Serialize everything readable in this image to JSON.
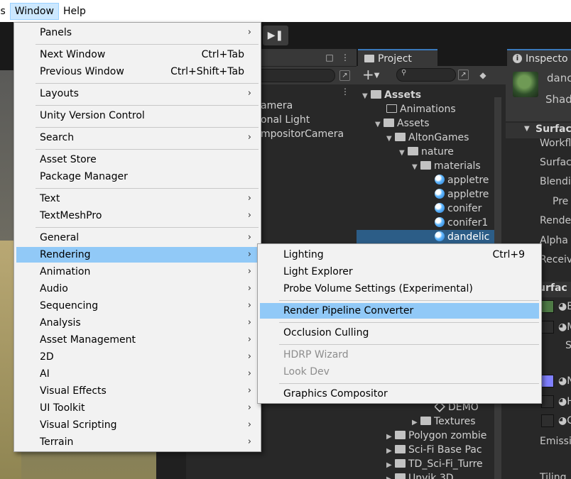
{
  "menubar": {
    "items": [
      "ols",
      "Window",
      "Help"
    ]
  },
  "toolbar": {
    "step_icon": "step-forward-icon"
  },
  "hierarchy": {
    "rows": [
      "amera",
      "onal Light",
      "mpositorCamera"
    ]
  },
  "project": {
    "tab_label": "Project",
    "add_label": "+",
    "tree": [
      {
        "label": "Assets",
        "bold": true
      },
      {
        "label": "Animations"
      },
      {
        "label": "Assets"
      },
      {
        "label": "AltonGames"
      },
      {
        "label": "nature"
      },
      {
        "label": "materials"
      },
      {
        "label": "appletre"
      },
      {
        "label": "appletre"
      },
      {
        "label": "conifer"
      },
      {
        "label": "conifer1"
      },
      {
        "label": "dandelic"
      },
      {
        "label": "DEMO"
      },
      {
        "label": "Textures"
      },
      {
        "label": "Polygon zombie"
      },
      {
        "label": "Sci-Fi Base Pac"
      },
      {
        "label": "TD_Sci-Fi_Turre"
      },
      {
        "label": "Unyik 3D"
      }
    ]
  },
  "inspector": {
    "tab_label": "Inspecto",
    "name": "danc",
    "shader": "Shad",
    "section1": "Surfac",
    "fields": [
      "Workfl",
      "Surfac",
      "Blendi",
      "Pre",
      "Rende",
      "Alpha",
      "Receiv"
    ],
    "section2": "urfac",
    "map_letters": [
      "B",
      "M",
      "S",
      "N",
      "H",
      "C"
    ],
    "emission": "Emissi",
    "tiling": "Tiling",
    "colors": {
      "base_map": "#4e7a45",
      "normal_map": "#8080ff"
    }
  },
  "window_menu": {
    "items": [
      {
        "label": "Panels",
        "submenu": true
      },
      {
        "sep": true
      },
      {
        "label": "Next Window",
        "shortcut": "Ctrl+Tab"
      },
      {
        "label": "Previous Window",
        "shortcut": "Ctrl+Shift+Tab"
      },
      {
        "sep": true
      },
      {
        "label": "Layouts",
        "submenu": true
      },
      {
        "sep": true
      },
      {
        "label": "Unity Version Control"
      },
      {
        "sep": true
      },
      {
        "label": "Search",
        "submenu": true
      },
      {
        "sep": true
      },
      {
        "label": "Asset Store"
      },
      {
        "label": "Package Manager"
      },
      {
        "sep": true
      },
      {
        "label": "Text",
        "submenu": true
      },
      {
        "label": "TextMeshPro",
        "submenu": true
      },
      {
        "sep": true
      },
      {
        "label": "General",
        "submenu": true
      },
      {
        "label": "Rendering",
        "submenu": true,
        "highlight": true
      },
      {
        "label": "Animation",
        "submenu": true
      },
      {
        "label": "Audio",
        "submenu": true
      },
      {
        "label": "Sequencing",
        "submenu": true
      },
      {
        "label": "Analysis",
        "submenu": true
      },
      {
        "label": "Asset Management",
        "submenu": true
      },
      {
        "label": "2D",
        "submenu": true
      },
      {
        "label": "AI",
        "submenu": true
      },
      {
        "label": "Visual Effects",
        "submenu": true
      },
      {
        "label": "UI Toolkit",
        "submenu": true
      },
      {
        "label": "Visual Scripting",
        "submenu": true
      },
      {
        "label": "Terrain",
        "submenu": true
      }
    ]
  },
  "rendering_menu": {
    "items": [
      {
        "label": "Lighting",
        "shortcut": "Ctrl+9"
      },
      {
        "label": "Light Explorer"
      },
      {
        "label": "Probe Volume Settings (Experimental)"
      },
      {
        "sep": true
      },
      {
        "label": "Render Pipeline Converter",
        "highlight": true
      },
      {
        "sep": true
      },
      {
        "label": "Occlusion Culling"
      },
      {
        "sep": true
      },
      {
        "label": "HDRP Wizard",
        "disabled": true
      },
      {
        "label": "Look Dev",
        "disabled": true
      },
      {
        "sep": true
      },
      {
        "label": "Graphics Compositor"
      }
    ]
  }
}
